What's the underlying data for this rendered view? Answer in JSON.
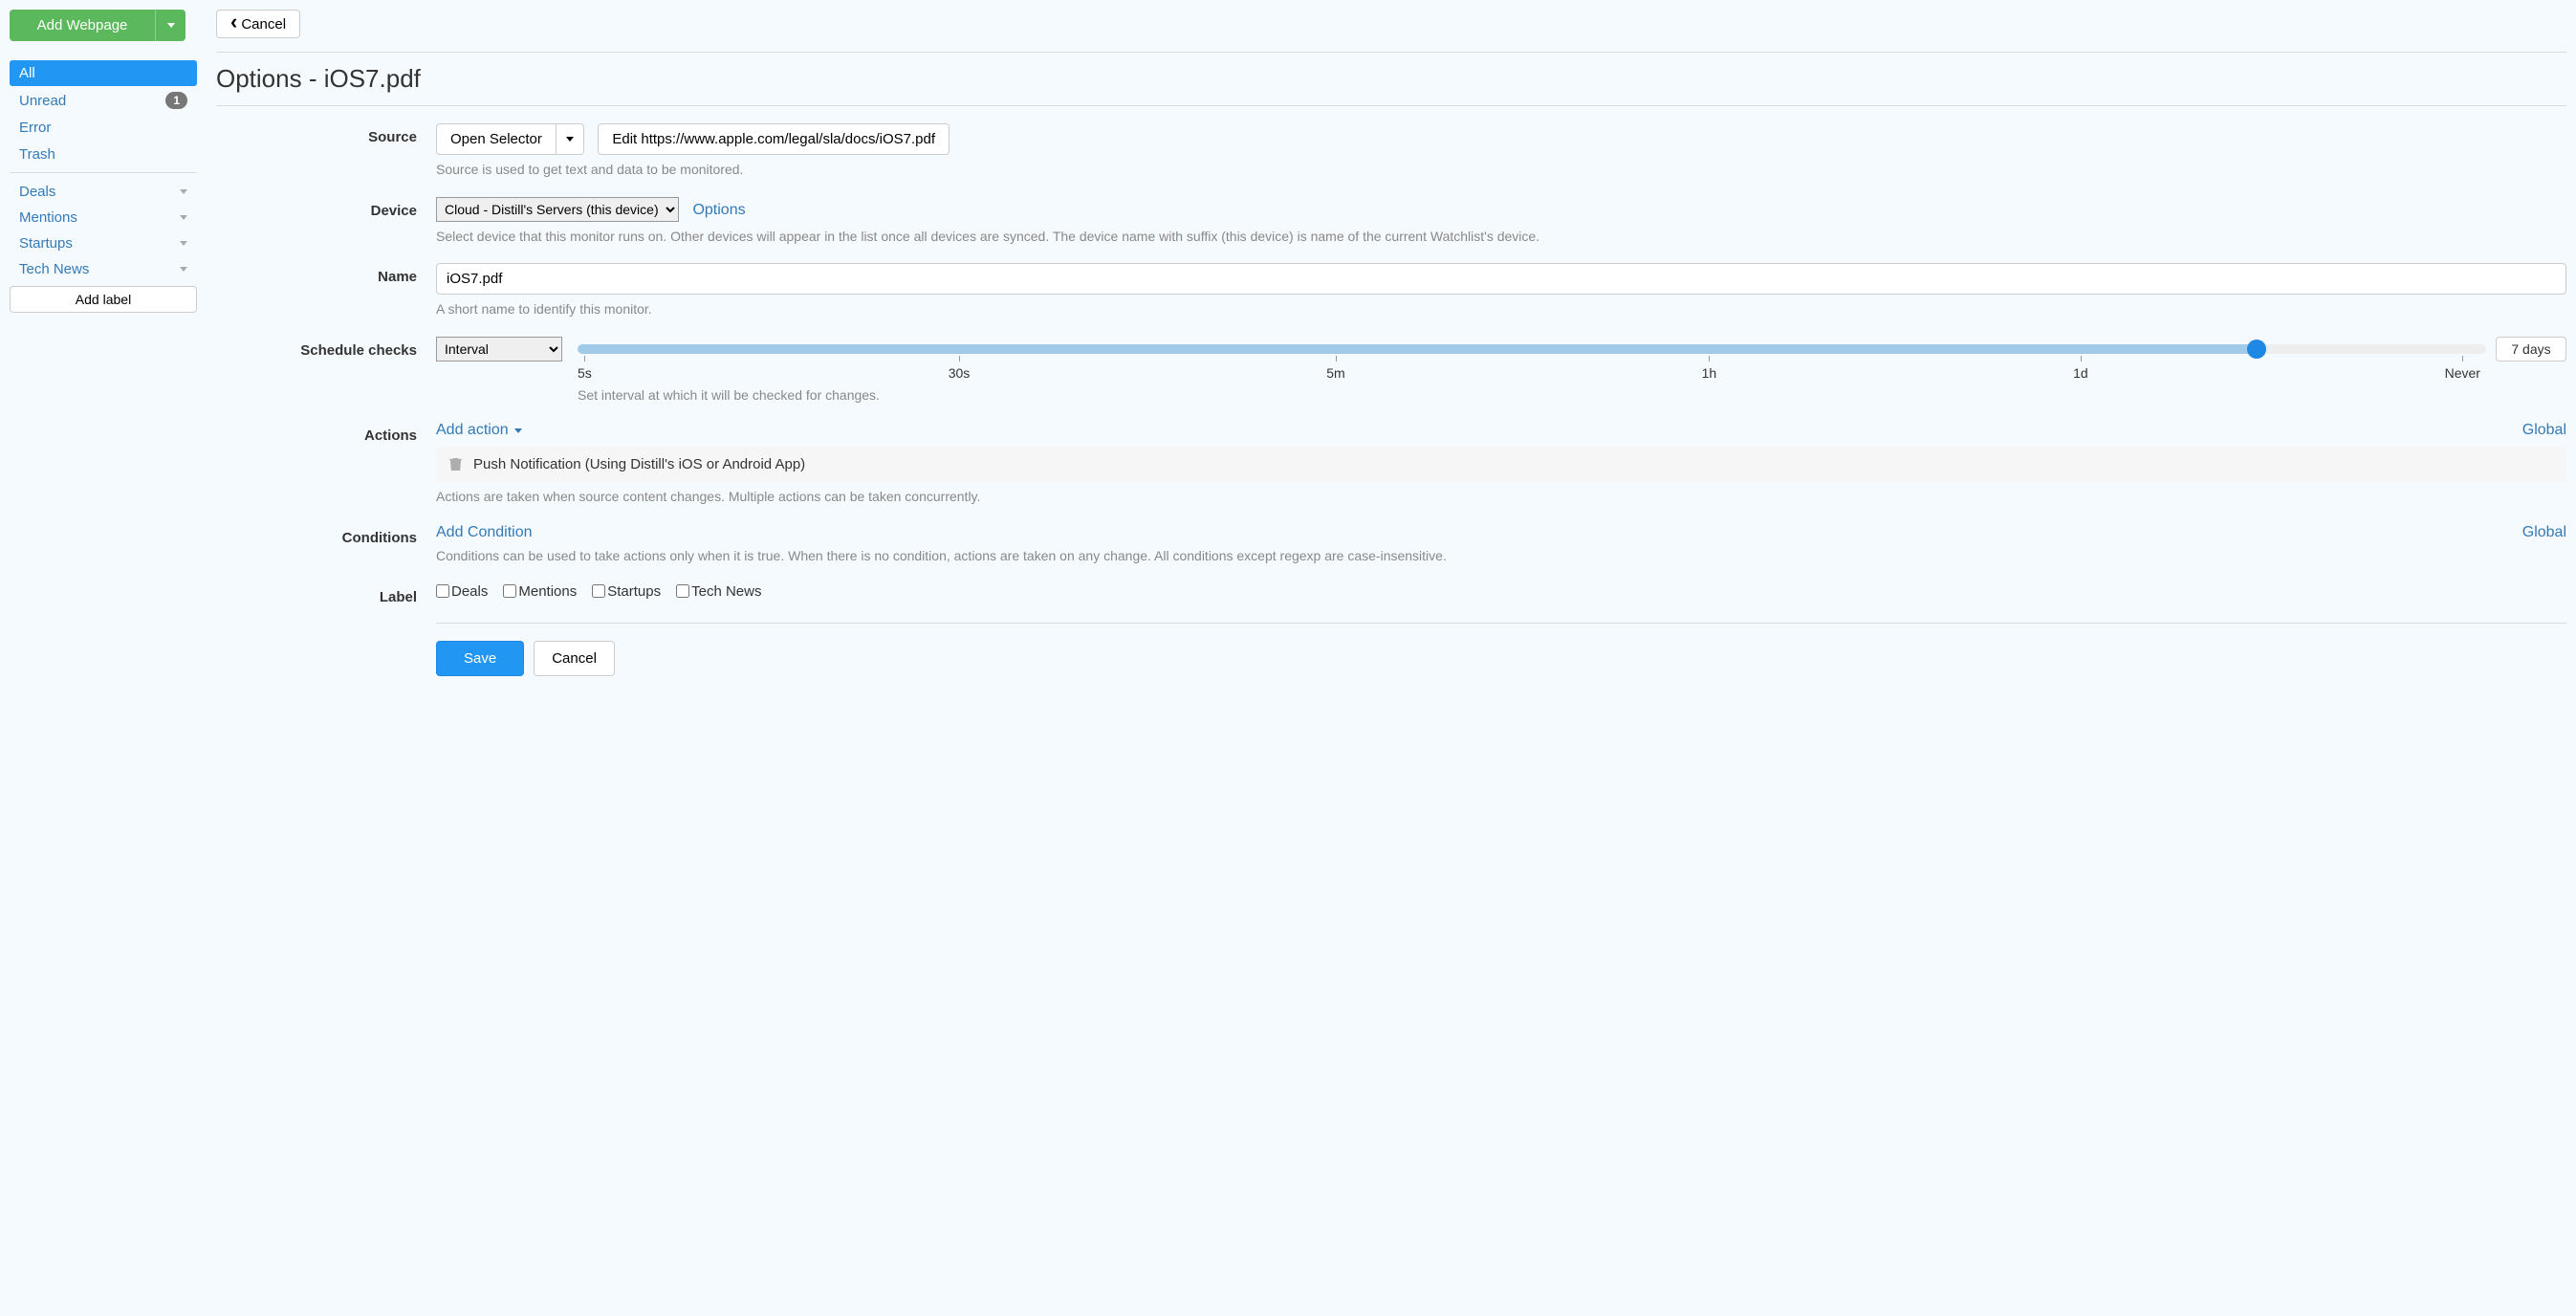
{
  "sidebar": {
    "add_webpage_label": "Add Webpage",
    "filters": [
      {
        "label": "All",
        "active": true
      },
      {
        "label": "Unread",
        "badge": "1"
      },
      {
        "label": "Error"
      },
      {
        "label": "Trash"
      }
    ],
    "labels": [
      {
        "label": "Deals"
      },
      {
        "label": "Mentions"
      },
      {
        "label": "Startups"
      },
      {
        "label": "Tech News"
      }
    ],
    "add_label_btn": "Add label"
  },
  "header": {
    "cancel_label": "Cancel",
    "page_title": "Options - iOS7.pdf"
  },
  "form": {
    "source": {
      "label": "Source",
      "open_selector_btn": "Open Selector",
      "edit_btn": "Edit https://www.apple.com/legal/sla/docs/iOS7.pdf",
      "help": "Source is used to get text and data to be monitored."
    },
    "device": {
      "label": "Device",
      "selected": "Cloud - Distill's Servers (this device)",
      "options_link": "Options",
      "help": "Select device that this monitor runs on. Other devices will appear in the list once all devices are synced. The device name with suffix (this device) is name of the current Watchlist's device."
    },
    "name": {
      "label": "Name",
      "value": "iOS7.pdf",
      "help": "A short name to identify this monitor."
    },
    "schedule": {
      "label": "Schedule checks",
      "mode": "Interval",
      "value_label": "7 days",
      "slider_percent": 88,
      "ticks": [
        "5s",
        "30s",
        "5m",
        "1h",
        "1d",
        "Never"
      ],
      "help": "Set interval at which it will be checked for changes."
    },
    "actions": {
      "label": "Actions",
      "add_action_label": "Add action",
      "global_label": "Global",
      "items": [
        {
          "text": "Push Notification (Using Distill's iOS or Android App)"
        }
      ],
      "help": "Actions are taken when source content changes. Multiple actions can be taken concurrently."
    },
    "conditions": {
      "label": "Conditions",
      "add_condition_label": "Add Condition",
      "global_label": "Global",
      "help": "Conditions can be used to take actions only when it is true. When there is no condition, actions are taken on any change. All conditions except regexp are case-insensitive."
    },
    "label_section": {
      "label": "Label",
      "options": [
        "Deals",
        "Mentions",
        "Startups",
        "Tech News"
      ]
    }
  },
  "footer": {
    "save_label": "Save",
    "cancel_label": "Cancel"
  }
}
